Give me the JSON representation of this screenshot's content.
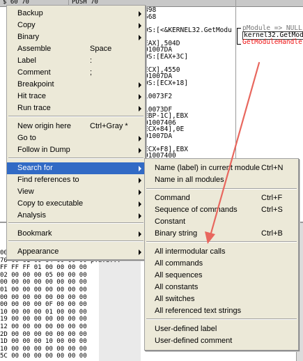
{
  "disassembly": {
    "top_strip": [
      "$ 60 70",
      "PUSH 70"
    ],
    "lines": [
      "898",
      "568",
      "",
      "DS:[<&KERNEL32.GetModu",
      "",
      "EAX],504D",
      "01007DA",
      "DS:[EAX+3C]",
      "",
      "ECX],4550",
      "01007DA",
      "DS:[ECX+18]",
      "",
      "10073F2",
      "",
      "10073DF",
      "EBP-1C],EBX",
      "01007406",
      "ECX+84],0E",
      "01007DA",
      "",
      "ECX+F8],EBX",
      "01007400",
      "ECX+E8],0E",
      "01007DA"
    ],
    "comments": {
      "first": "pModule => NULL",
      "second": "kernel32.GetModu",
      "third": "GetModuleHandle"
    }
  },
  "dump": {
    "rows": [
      "00 00 00 00 00 00 ....",
      "70 00 61 00 64 00 00 00 p.a.d...",
      "FF FF FF 01 00 00 00 00",
      "02 00 00 00 05 00 00 00",
      "00 00 00 00 00 00 00 00",
      "01 00 00 00 00 00 00 00",
      "00 00 00 00 00 00 00 00",
      "00 00 00 00 0F 00 00 00",
      "10 00 00 00 01 00 00 00",
      "19 00 00 00 00 00 00 00",
      "12 00 00 00 00 00 00 00",
      "2D 00 00 00 00 00 00 00",
      "1D 00 00 00 10 00 00 00",
      "10 00 00 00 00 00 00 00",
      "5C 00 00 00 00 00 00 00"
    ]
  },
  "context_menu": {
    "items": [
      {
        "label": "Backup",
        "shortcut": "",
        "submenu": true
      },
      {
        "label": "Copy",
        "shortcut": "",
        "submenu": true
      },
      {
        "label": "Binary",
        "shortcut": "",
        "submenu": true
      },
      {
        "label": "Assemble",
        "shortcut": "Space",
        "submenu": false
      },
      {
        "label": "Label",
        "shortcut": ":",
        "submenu": false
      },
      {
        "label": "Comment",
        "shortcut": ";",
        "submenu": false
      },
      {
        "label": "Breakpoint",
        "shortcut": "",
        "submenu": true
      },
      {
        "label": "Hit trace",
        "shortcut": "",
        "submenu": true
      },
      {
        "label": "Run trace",
        "shortcut": "",
        "submenu": true
      },
      {
        "label": "New origin here",
        "shortcut": "Ctrl+Gray *",
        "submenu": false
      },
      {
        "label": "Go to",
        "shortcut": "",
        "submenu": true
      },
      {
        "label": "Follow in Dump",
        "shortcut": "",
        "submenu": true
      },
      {
        "label": "Search for",
        "shortcut": "",
        "submenu": true,
        "selected": true
      },
      {
        "label": "Find references to",
        "shortcut": "",
        "submenu": true
      },
      {
        "label": "View",
        "shortcut": "",
        "submenu": true
      },
      {
        "label": "Copy to executable",
        "shortcut": "",
        "submenu": true
      },
      {
        "label": "Analysis",
        "shortcut": "",
        "submenu": true
      },
      {
        "label": "Bookmark",
        "shortcut": "",
        "submenu": true
      },
      {
        "label": "Appearance",
        "shortcut": "",
        "submenu": true
      }
    ]
  },
  "search_submenu": {
    "items": [
      {
        "label": "Name (label) in current module",
        "shortcut": "Ctrl+N"
      },
      {
        "label": "Name in all modules",
        "shortcut": ""
      },
      {
        "label": "Command",
        "shortcut": "Ctrl+F"
      },
      {
        "label": "Sequence of commands",
        "shortcut": "Ctrl+S"
      },
      {
        "label": "Constant",
        "shortcut": ""
      },
      {
        "label": "Binary string",
        "shortcut": "Ctrl+B"
      },
      {
        "label": "All intermodular calls",
        "shortcut": ""
      },
      {
        "label": "All commands",
        "shortcut": ""
      },
      {
        "label": "All sequences",
        "shortcut": ""
      },
      {
        "label": "All constants",
        "shortcut": ""
      },
      {
        "label": "All switches",
        "shortcut": ""
      },
      {
        "label": "All referenced text strings",
        "shortcut": ""
      },
      {
        "label": "User-defined label",
        "shortcut": ""
      },
      {
        "label": "User-defined comment",
        "shortcut": ""
      }
    ]
  },
  "colors": {
    "menu_bg": "#ece9d8",
    "highlight": "#316ac5",
    "annotation_arrow": "#e8675e",
    "comment_red": "#e11111"
  }
}
